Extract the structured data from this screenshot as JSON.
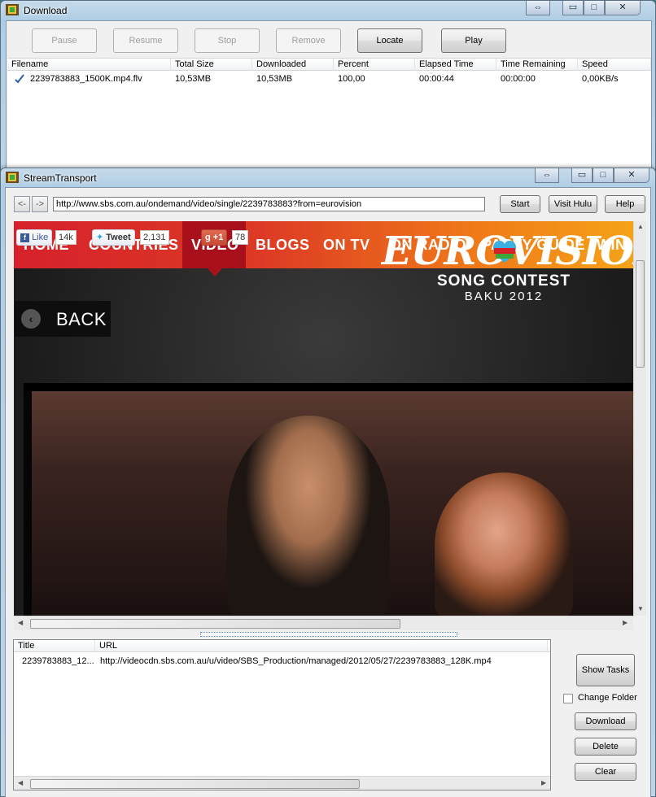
{
  "download_window": {
    "title": "Download",
    "caption_restore": "⇔",
    "caption_minimize": "▭",
    "caption_maximize": "□",
    "caption_close": "✕",
    "buttons": {
      "pause": "Pause",
      "resume": "Resume",
      "stop": "Stop",
      "remove": "Remove",
      "locate": "Locate",
      "play": "Play"
    },
    "columns": [
      "Filename",
      "Total Size",
      "Downloaded",
      "Percent",
      "Elapsed Time",
      "Time Remaining",
      "Speed"
    ],
    "rows": [
      [
        "2239783883_1500K.mp4.flv",
        "10,53MB",
        "10,53MB",
        "100,00",
        "00:00:44",
        "00:00:00",
        "0,00KB/s"
      ]
    ]
  },
  "stream_window": {
    "title": "StreamTransport",
    "back": "<-",
    "forward": "->",
    "url": "http://www.sbs.com.au/ondemand/video/single/2239783883?from=eurovision",
    "buttons": {
      "start": "Start",
      "visit_hulu": "Visit Hulu",
      "help": "Help"
    },
    "webpage": {
      "nav": [
        "HOME",
        "COUNTRIES",
        "VIDEO",
        "BLOGS",
        "ON TV",
        "ON RADIO",
        "PARTY GUIDE",
        "WIN"
      ],
      "social": {
        "like": "Like",
        "like_count": "14k",
        "tweet": "Tweet",
        "tweet_count": "2,131",
        "plusone": "+1",
        "plusone_count": "78"
      },
      "back": "BACK",
      "logo": {
        "main": "EUROVISION",
        "sub": "SONG CONTEST",
        "place": "BAKU 2012"
      }
    },
    "media_list": {
      "columns": [
        "Title",
        "URL"
      ],
      "rows": [
        [
          "2239783883_12...",
          "http://videocdn.sbs.com.au/u/video/SBS_Production/managed/2012/05/27/2239783883_128K.mp4"
        ]
      ]
    },
    "side_buttons": {
      "show_tasks": "Show Tasks",
      "change_folder": "Change Folder",
      "download": "Download",
      "delete": "Delete",
      "clear": "Clear"
    }
  },
  "colors": {
    "accent_red": "#d6212b",
    "accent_orange": "#f5a318",
    "selection_blue": "#3399ff"
  }
}
